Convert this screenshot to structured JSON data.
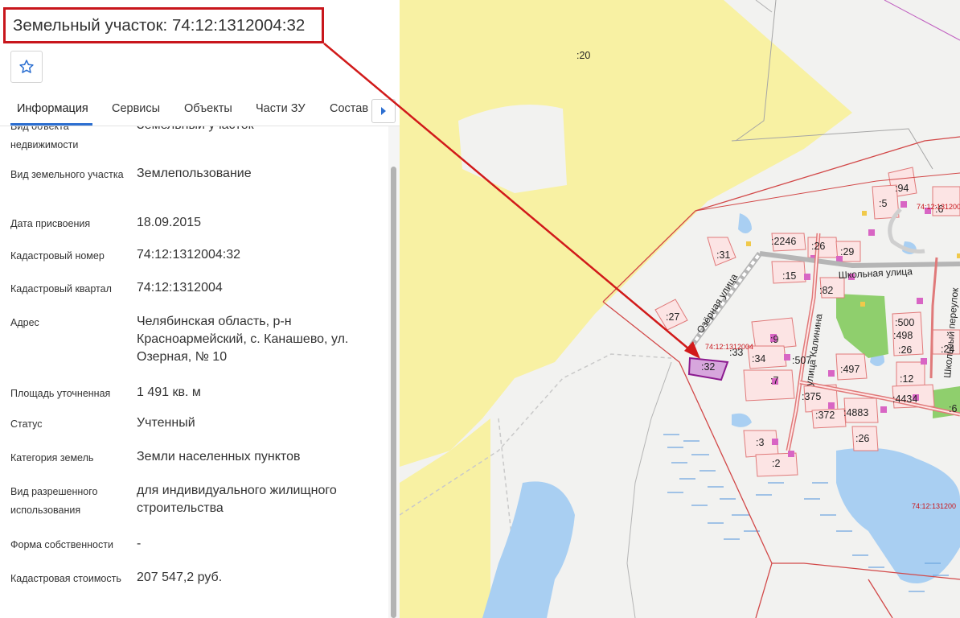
{
  "header": {
    "title": "Земельный участок: 74:12:1312004:32"
  },
  "tabs": [
    {
      "label": "Информация"
    },
    {
      "label": "Сервисы"
    },
    {
      "label": "Объекты"
    },
    {
      "label": "Части ЗУ"
    },
    {
      "label": "Состав"
    }
  ],
  "fields": [
    {
      "label": "Вид объекта недвижимости",
      "value": "Земельный участок"
    },
    {
      "label": "Вид земельного участка",
      "value": "Землепользование"
    },
    {
      "label": "Дата присвоения",
      "value": "18.09.2015"
    },
    {
      "label": "Кадастровый номер",
      "value": "74:12:1312004:32"
    },
    {
      "label": "Кадастровый квартал",
      "value": "74:12:1312004"
    },
    {
      "label": "Адрес",
      "value": "Челябинская область, р-н Красноармейский, с. Канашево, ул. Озерная, № 10"
    },
    {
      "label": "Площадь уточненная",
      "value": "1 491 кв. м"
    },
    {
      "label": "Статус",
      "value": "Учтенный"
    },
    {
      "label": "Категория земель",
      "value": "Земли населенных пунктов"
    },
    {
      "label": "Вид разрешенного использования",
      "value": "для индивидуального жилищного строительства"
    },
    {
      "label": "Форма собственности",
      "value": "-"
    },
    {
      "label": "Кадастровая стоимость",
      "value": "207 547,2 руб."
    }
  ],
  "map": {
    "parcel_labels": [
      ":20",
      ":31",
      ":27",
      ":2246",
      ":26",
      ":29",
      ":15",
      ":82",
      ":94",
      ":5",
      ":6",
      ":9",
      ":34",
      ":33",
      ":507",
      ":497",
      ":7",
      ":375",
      ":372",
      ":4883",
      ":3",
      ":2",
      ":26",
      ":500",
      ":498",
      ":26",
      ":24",
      ":12",
      ":4434",
      ":6"
    ],
    "selected_parcel": ":32",
    "quarter_labels": [
      "74:12:1312004",
      "74:12:1312004",
      "74:12:131200"
    ],
    "streets": [
      "Озёрная улица",
      "Школьная улица",
      "Школьный переулок",
      "улица Калинина"
    ]
  },
  "colors": {
    "accent": "#2c6fd1",
    "highlight": "#c8161c",
    "parcel_selected": "#8b1a8f"
  }
}
